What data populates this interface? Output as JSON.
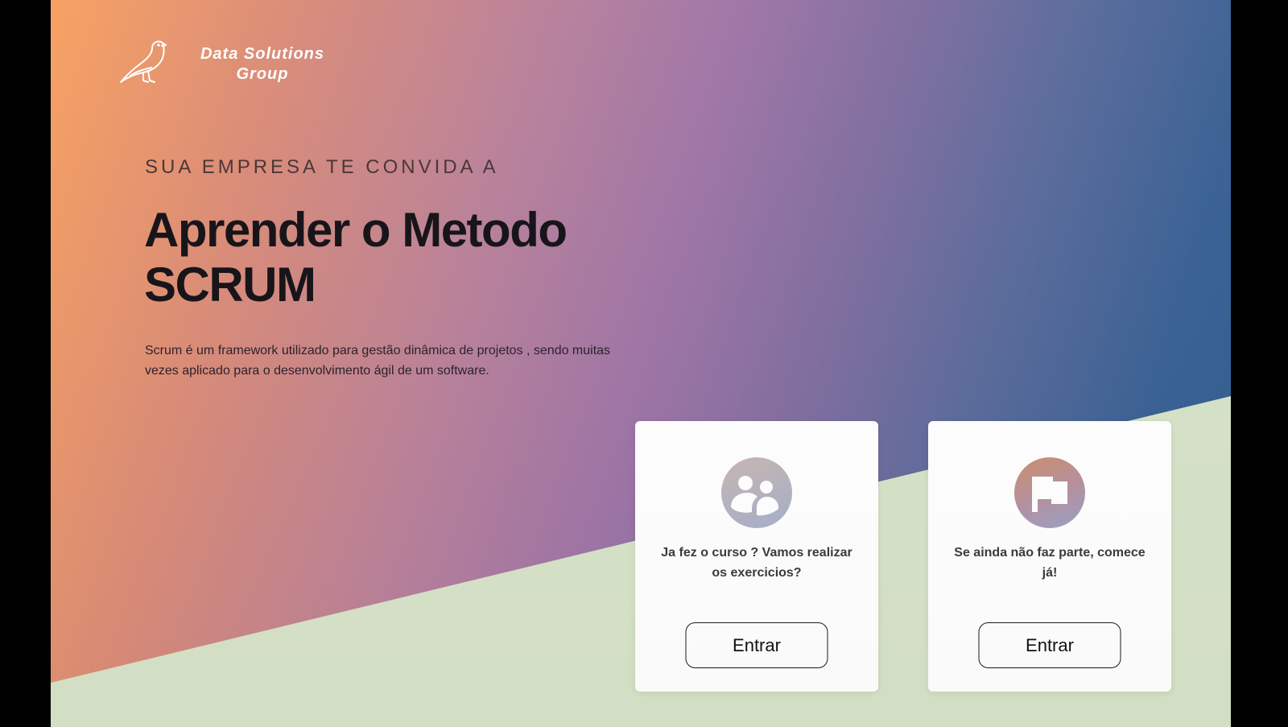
{
  "brand": {
    "name_line1": "Data Solutions",
    "name_line2": "Group",
    "logo_icon": "bird-icon"
  },
  "hero": {
    "eyebrow": "SUA EMPRESA TE CONVIDA A",
    "title_line1": "Aprender o Metodo",
    "title_line2": "SCRUM",
    "description": "Scrum é um framework utilizado para gestão dinâmica de projetos , sendo muitas vezes aplicado para o desenvolvimento ágil de um software."
  },
  "cards": [
    {
      "icon": "group-users-icon",
      "text": "Ja fez o curso ? Vamos realizar os exercicios?",
      "button_label": "Entrar"
    },
    {
      "icon": "flag-icon",
      "text": "Se ainda não faz parte, comece já!",
      "button_label": "Entrar"
    }
  ],
  "colors": {
    "gradient_start": "#f7a060",
    "gradient_mid": "#9f75a6",
    "gradient_end": "#2e5d92",
    "ground": "#d7e3c8",
    "card_bg": "#ffffff"
  }
}
